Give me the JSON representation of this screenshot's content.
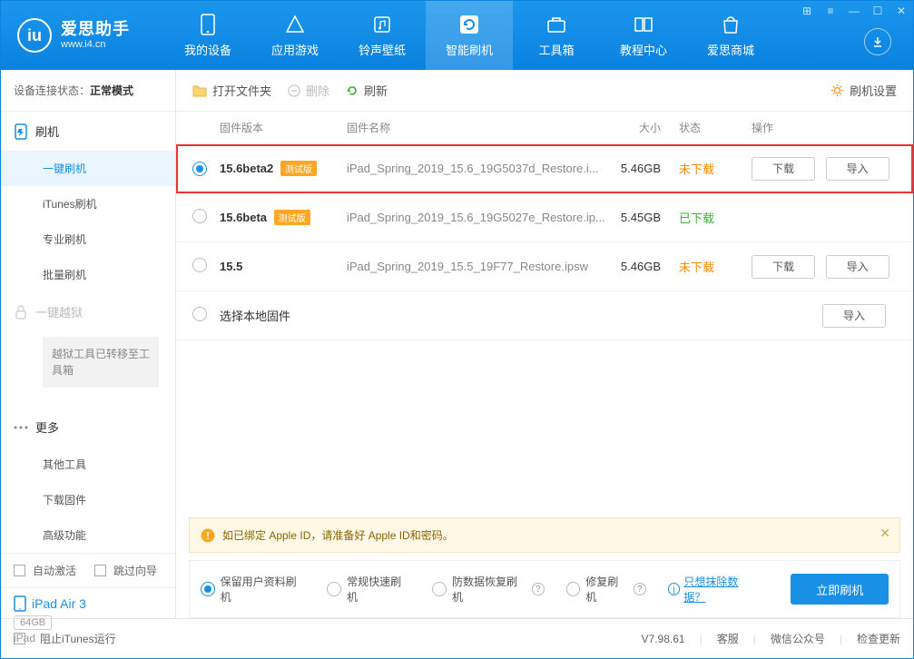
{
  "app": {
    "title": "爱思助手",
    "subtitle": "www.i4.cn"
  },
  "nav": {
    "items": [
      {
        "label": "我的设备"
      },
      {
        "label": "应用游戏"
      },
      {
        "label": "铃声壁纸"
      },
      {
        "label": "智能刷机"
      },
      {
        "label": "工具箱"
      },
      {
        "label": "教程中心"
      },
      {
        "label": "爱思商城"
      }
    ],
    "active": 3
  },
  "sidebar": {
    "conn_label": "设备连接状态：",
    "conn_value": "正常模式",
    "section_flash": "刷机",
    "items_flash": [
      {
        "label": "一键刷机",
        "active": true
      },
      {
        "label": "iTunes刷机"
      },
      {
        "label": "专业刷机"
      },
      {
        "label": "批量刷机"
      }
    ],
    "section_jailbreak": "一键越狱",
    "jailbreak_note": "越狱工具已转移至工具箱",
    "section_more": "更多",
    "items_more": [
      {
        "label": "其他工具"
      },
      {
        "label": "下载固件"
      },
      {
        "label": "高级功能"
      }
    ],
    "auto_activate": "自动激活",
    "skip_guide": "跳过向导",
    "device_name": "iPad Air 3",
    "device_storage": "64GB",
    "device_type": "iPad"
  },
  "toolbar": {
    "open_folder": "打开文件夹",
    "delete": "删除",
    "refresh": "刷新",
    "settings": "刷机设置"
  },
  "table": {
    "headers": {
      "version": "固件版本",
      "name": "固件名称",
      "size": "大小",
      "status": "状态",
      "actions": "操作"
    },
    "rows": [
      {
        "selected": true,
        "version": "15.6beta2",
        "beta": "测试版",
        "name": "iPad_Spring_2019_15.6_19G5037d_Restore.i...",
        "size": "5.46GB",
        "status": "未下载",
        "status_class": "orange",
        "download": "下载",
        "import": "导入",
        "highlight": true
      },
      {
        "selected": false,
        "version": "15.6beta",
        "beta": "测试版",
        "name": "iPad_Spring_2019_15.6_19G5027e_Restore.ip...",
        "size": "5.45GB",
        "status": "已下载",
        "status_class": "green"
      },
      {
        "selected": false,
        "version": "15.5",
        "name": "iPad_Spring_2019_15.5_19F77_Restore.ipsw",
        "size": "5.46GB",
        "status": "未下载",
        "status_class": "orange",
        "download": "下载",
        "import": "导入"
      },
      {
        "selected": false,
        "local": "选择本地固件",
        "import": "导入"
      }
    ]
  },
  "notice": "如已绑定 Apple ID，请准备好 Apple ID和密码。",
  "options": {
    "opt1": "保留用户资料刷机",
    "opt2": "常规快速刷机",
    "opt3": "防数据恢复刷机",
    "opt4": "修复刷机",
    "erase_link": "只想抹除数据？",
    "flash_btn": "立即刷机"
  },
  "footer": {
    "block_itunes": "阻止iTunes运行",
    "version": "V7.98.61",
    "service": "客服",
    "wechat": "微信公众号",
    "check_update": "检查更新"
  }
}
